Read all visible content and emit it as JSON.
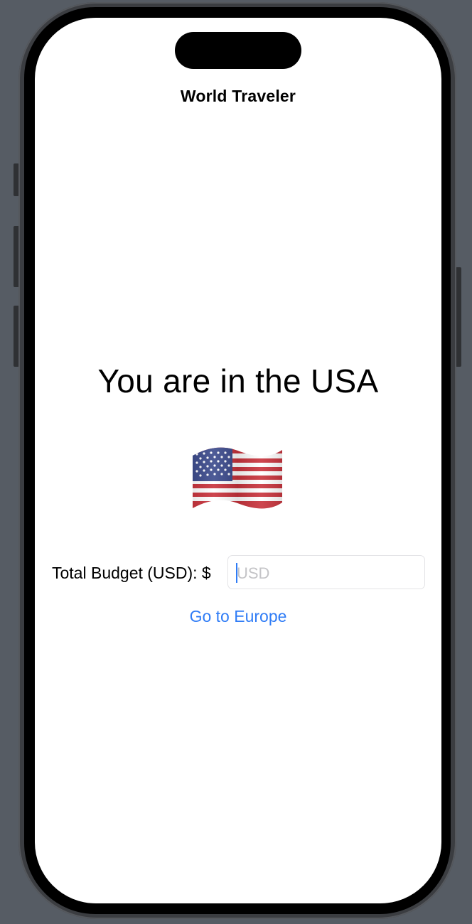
{
  "app": {
    "nav_title": "World Traveler"
  },
  "main": {
    "headline": "You are in the USA",
    "flag_icon": "us-flag-icon",
    "budget": {
      "label": "Total Budget (USD): $",
      "input_value": "",
      "input_placeholder": "USD"
    },
    "link_label": "Go to Europe"
  },
  "colors": {
    "accent": "#2f7cf6",
    "background": "#ffffff",
    "frame": "#000000"
  }
}
